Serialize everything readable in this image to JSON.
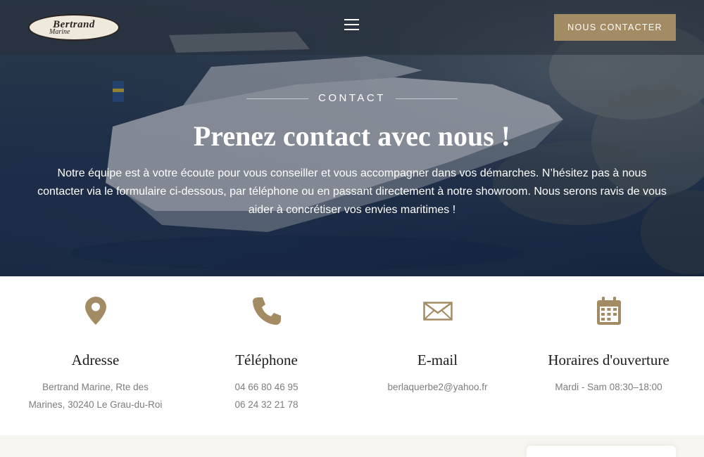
{
  "colors": {
    "accent": "#a38b64",
    "heading": "#1c1c1c",
    "muted": "#7d7d7d"
  },
  "header": {
    "logo": {
      "title": "Bertrand",
      "subtitle": "Marine"
    },
    "menu_icon": "hamburger-menu-icon",
    "contact_button": "NOUS CONTACTER"
  },
  "hero": {
    "eyebrow": "CONTACT",
    "title": "Prenez contact avec nous !",
    "description": "Notre équipe est à votre écoute pour vous conseiller et vous accompagner dans vos démarches. N’hésitez pas à nous contacter via le formulaire ci-dessous, par téléphone ou en passant directement à notre showroom. Nous serons ravis de vous aider à concrétiser vos envies maritimes !"
  },
  "info": {
    "address": {
      "icon": "map-pin-icon",
      "title": "Adresse",
      "line1": "Bertrand Marine, Rte des",
      "line2": "Marines, 30240 Le Grau-du-Roi"
    },
    "phone": {
      "icon": "phone-icon",
      "title": "Téléphone",
      "line1": "04 66 80 46 95",
      "line2": "06 24 32 21 78"
    },
    "email": {
      "icon": "envelope-icon",
      "title": "E-mail",
      "line1": "berlaquerbe2@yahoo.fr"
    },
    "hours": {
      "icon": "calendar-icon",
      "title": "Horaires d'ouverture",
      "line1": "Mardi - Sam 08:30–18:00"
    }
  }
}
